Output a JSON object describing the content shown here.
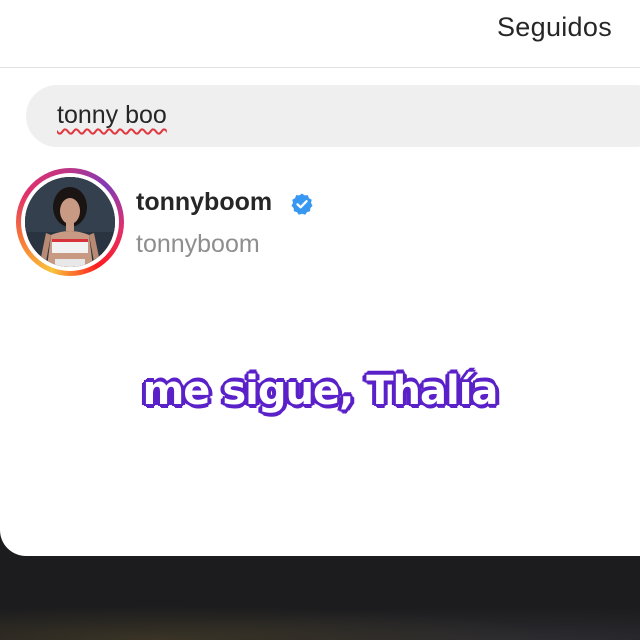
{
  "header": {
    "title": "Seguidos"
  },
  "search": {
    "value": "tonny boo"
  },
  "results": [
    {
      "username": "tonnyboom",
      "full_name": "tonnyboom",
      "verified": true,
      "has_story_ring": true
    }
  ],
  "caption": {
    "text": "me sigue, Thalía"
  },
  "colors": {
    "verified_badge": "#3897f0",
    "caption_outline": "#5b21c9",
    "spellcheck_underline": "#e0383e",
    "background_dark": "#1c1c1e"
  },
  "icons": {
    "verified": "verified-badge-icon"
  }
}
